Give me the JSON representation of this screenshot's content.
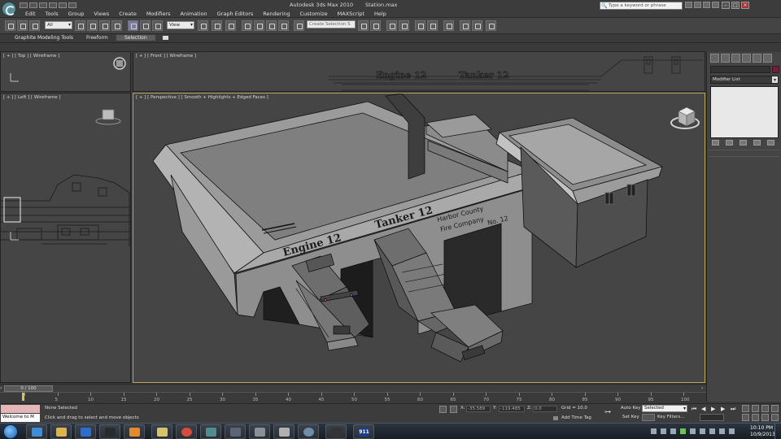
{
  "window": {
    "title": "Autodesk 3ds Max 2010",
    "document": "Station.max",
    "search_placeholder": "Type a keyword or phrase"
  },
  "menu": [
    "Edit",
    "Tools",
    "Group",
    "Views",
    "Create",
    "Modifiers",
    "Animation",
    "Graph Editors",
    "Rendering",
    "Customize",
    "MAXScript",
    "Help"
  ],
  "toolbar": {
    "filter_value": "All",
    "refcoord_value": "View",
    "selection_set_placeholder": "Create Selection S"
  },
  "ribbon": {
    "tabs": [
      "Graphite Modeling Tools",
      "Freeform",
      "Selection"
    ],
    "active_tab": "Selection"
  },
  "viewports": {
    "top": "[ + ] [ Top ] [ Wireframe ]",
    "front": "[ + ] [ Front ] [ Wireframe ]",
    "left": "[ + ] [ Left ] [ Wireframe ]",
    "perspective": "[ + ] [ Perspective ] [ Smooth + Highlights + Edged Faces ]"
  },
  "scene": {
    "sign_engine": "Engine 12",
    "sign_tanker": "Tanker 12",
    "sign_company_line1": "Harbor County",
    "sign_company_line2": "Fire Company",
    "sign_company_line3": "No. 12"
  },
  "command_panel": {
    "modifier_list": "Modifier List"
  },
  "timeline": {
    "frame_readout": "0 / 100",
    "ticks": [
      "0",
      "5",
      "10",
      "15",
      "20",
      "25",
      "30",
      "35",
      "40",
      "45",
      "50",
      "55",
      "60",
      "65",
      "70",
      "75",
      "80",
      "85",
      "90",
      "95",
      "100"
    ]
  },
  "status": {
    "listener_text": "Welcome to M",
    "selection": "None Selected",
    "prompt": "Click and drag to select and move objects",
    "x_label": "X:",
    "x_value": "-35.589",
    "y_label": "Y:",
    "y_value": "-119.485",
    "z_label": "Z:",
    "z_value": "0.0",
    "grid": "Grid = 10.0",
    "add_time_tag": "Add Time Tag",
    "auto_key": "Auto Key",
    "set_key": "Set Key",
    "key_mode": "Selected",
    "key_filters": "Key Filters..."
  },
  "taskbar": {
    "time": "10:10 PM",
    "date": "10/9/2013",
    "app_label_911": "911"
  }
}
